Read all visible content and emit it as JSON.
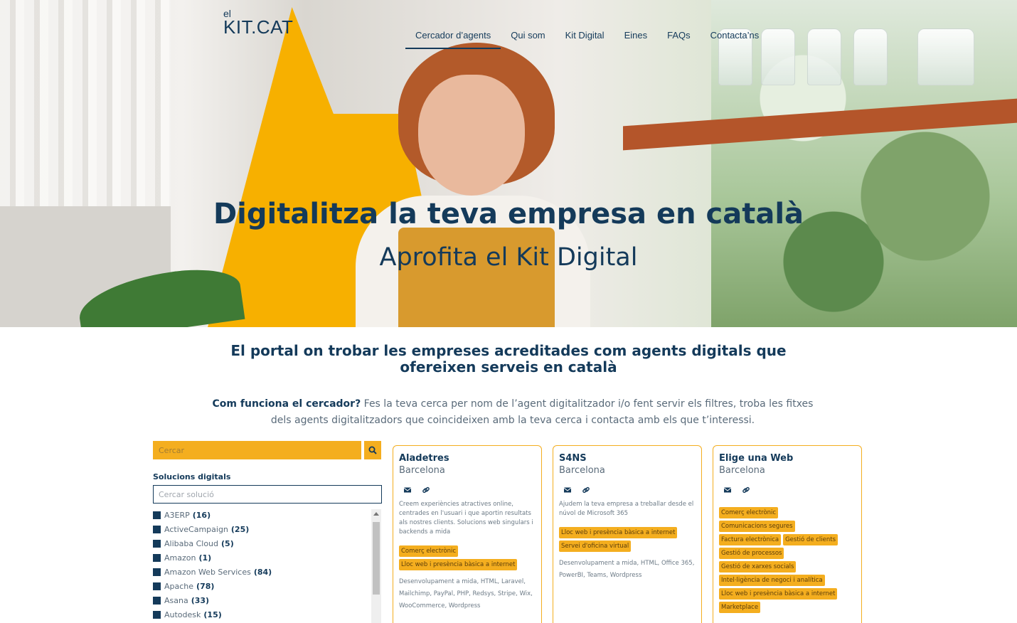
{
  "logo": {
    "el": "el",
    "kit": "KIT.CAT"
  },
  "nav": [
    {
      "label": "Cercador d’agents",
      "active": true
    },
    {
      "label": "Qui som"
    },
    {
      "label": "Kit Digital"
    },
    {
      "label": "Eines"
    },
    {
      "label": "FAQs"
    },
    {
      "label": "Contacta’ns"
    }
  ],
  "hero": {
    "title": "Digitalitza la teva empresa en català",
    "subtitle": "Aprofita el Kit Digital"
  },
  "intro": {
    "title": "El portal on trobar les empreses acreditades com agents digitals que ofereixen serveis en català",
    "how_label": "Com funciona el cercador?",
    "how_text": " Fes la teva cerca per nom de l’agent digitalitzador i/o fent servir els filtres, troba les fitxes dels agents digitalitzadors que coincideixen amb la teva cerca i contacta amb els que t’interessi."
  },
  "search": {
    "placeholder": "Cercar",
    "button_icon": "search-icon"
  },
  "filters": {
    "title": "Solucions digitals",
    "placeholder": "Cercar solució",
    "items": [
      {
        "label": "A3ERP",
        "count": "(16)"
      },
      {
        "label": "ActiveCampaign",
        "count": "(25)"
      },
      {
        "label": "Alibaba Cloud",
        "count": "(5)"
      },
      {
        "label": "Amazon",
        "count": "(1)"
      },
      {
        "label": "Amazon Web Services",
        "count": "(84)"
      },
      {
        "label": "Apache",
        "count": "(78)"
      },
      {
        "label": "Asana",
        "count": "(33)"
      },
      {
        "label": "Autodesk",
        "count": "(15)"
      }
    ]
  },
  "cards": [
    {
      "name": "Aladetres",
      "city": "Barcelona",
      "desc": "Creem experiències atractives online, centrades en l'usuari i que aportin resultats als nostres clients. Solucions web singulars i backends a mida",
      "tags": [
        "Comerç electrònic",
        "Lloc web i presència bàsica a internet"
      ],
      "tech": "Desenvolupament a mida, HTML, Laravel, Mailchimp, PayPal, PHP, Redsys, Stripe, Wix, WooCommerce, Wordpress"
    },
    {
      "name": "S4NS",
      "city": "Barcelona",
      "desc": "Ajudem la teva empresa a treballar desde el núvol de Microsoft 365",
      "tags": [
        "Lloc web i presència bàsica a internet",
        "Servei d'oficina virtual"
      ],
      "tech": "Desenvolupament a mida, HTML, Office 365, PowerBI, Teams, Wordpress"
    },
    {
      "name": "Elige una Web",
      "city": "Barcelona",
      "desc": "",
      "tags": [
        "Comerç electrònic",
        "Comunicacions segures",
        "Factura electrònica",
        "Gestió de clients",
        "Gestió de processos",
        "Gestió de xarxes socials",
        "Intel·ligència de negoci i analítica",
        "Lloc web i presència bàsica a internet",
        "Marketplace"
      ],
      "tech": ""
    }
  ],
  "colors": {
    "navy": "#143a5a",
    "yellow": "#f4ae1f"
  }
}
